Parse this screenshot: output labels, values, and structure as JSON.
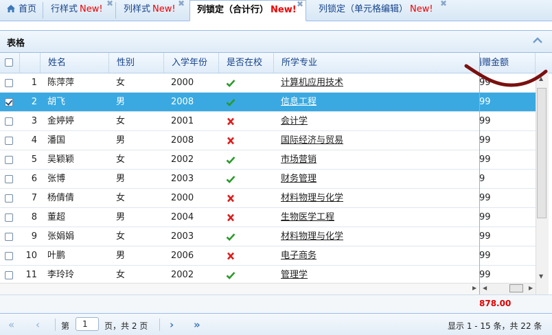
{
  "tabs": [
    {
      "label": "首页",
      "new": ""
    },
    {
      "label": "行样式",
      "new": "New!"
    },
    {
      "label": "列样式",
      "new": "New!"
    },
    {
      "label": "列锁定（合计行）",
      "new": "New!"
    },
    {
      "label": "列锁定（单元格编辑）",
      "new": "New!"
    }
  ],
  "panel": {
    "title": "表格"
  },
  "columns": [
    "姓名",
    "性别",
    "入学年份",
    "是否在校",
    "所学专业",
    "捐赠金额"
  ],
  "rows": [
    {
      "no": "1",
      "name": "陈萍萍",
      "gender": "女",
      "year": "2000",
      "enrolled": true,
      "major": "计算机应用技术",
      "amount": "99",
      "checked": false
    },
    {
      "no": "2",
      "name": "胡飞",
      "gender": "男",
      "year": "2008",
      "enrolled": true,
      "major": "信息工程",
      "amount": "99",
      "checked": true
    },
    {
      "no": "3",
      "name": "金婷婷",
      "gender": "女",
      "year": "2001",
      "enrolled": false,
      "major": "会计学",
      "amount": "99",
      "checked": false
    },
    {
      "no": "4",
      "name": "潘国",
      "gender": "男",
      "year": "2008",
      "enrolled": false,
      "major": "国际经济与贸易",
      "amount": "99",
      "checked": false
    },
    {
      "no": "5",
      "name": "吴颖颖",
      "gender": "女",
      "year": "2002",
      "enrolled": true,
      "major": "市场营销",
      "amount": "99",
      "checked": false
    },
    {
      "no": "6",
      "name": "张博",
      "gender": "男",
      "year": "2003",
      "enrolled": true,
      "major": "财务管理",
      "amount": "9",
      "checked": false
    },
    {
      "no": "7",
      "name": "杨倩倩",
      "gender": "女",
      "year": "2000",
      "enrolled": false,
      "major": "材料物理与化学",
      "amount": "99",
      "checked": false
    },
    {
      "no": "8",
      "name": "董超",
      "gender": "男",
      "year": "2004",
      "enrolled": false,
      "major": "生物医学工程",
      "amount": "99",
      "checked": false
    },
    {
      "no": "9",
      "name": "张娟娟",
      "gender": "女",
      "year": "2003",
      "enrolled": true,
      "major": "材料物理与化学",
      "amount": "99",
      "checked": false
    },
    {
      "no": "10",
      "name": "叶鹏",
      "gender": "男",
      "year": "2006",
      "enrolled": false,
      "major": "电子商务",
      "amount": "99",
      "checked": false
    },
    {
      "no": "11",
      "name": "李玲玲",
      "gender": "女",
      "year": "2002",
      "enrolled": true,
      "major": "管理学",
      "amount": "99",
      "checked": false
    }
  ],
  "summary": {
    "amount": "878.00"
  },
  "pager": {
    "prefix": "第",
    "page": "1",
    "suffix": "页，共 2 页",
    "info": "显示 1 - 15 条，共 22 条"
  },
  "colors": {
    "accent": "#3aa9e1",
    "new": "#e00000",
    "header_text": "#15428b",
    "check": "#2a9a2a",
    "cross": "#e01b1b",
    "annotation": "#7a1010"
  }
}
